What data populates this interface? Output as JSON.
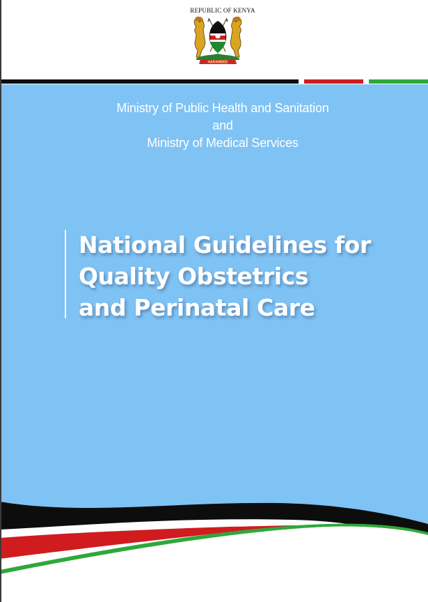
{
  "header": {
    "country": "REPUBLIC OF KENYA",
    "coat_of_arms_motto": "HARAMBEE"
  },
  "ministries": {
    "line1": "Ministry of Public Health and Sanitation",
    "line2": "and",
    "line3": "Ministry of Medical Services"
  },
  "title": {
    "line1": "National Guidelines for",
    "line2": "Quality Obstetrics",
    "line3": "and Perinatal Care"
  },
  "colors": {
    "panel": "#7fc2f4",
    "flag_black": "#0d0d0d",
    "flag_red": "#d01c1f",
    "flag_green": "#2ea83a",
    "text": "#ffffff"
  },
  "icons": {
    "emblem": "kenya-coat-of-arms-icon"
  }
}
